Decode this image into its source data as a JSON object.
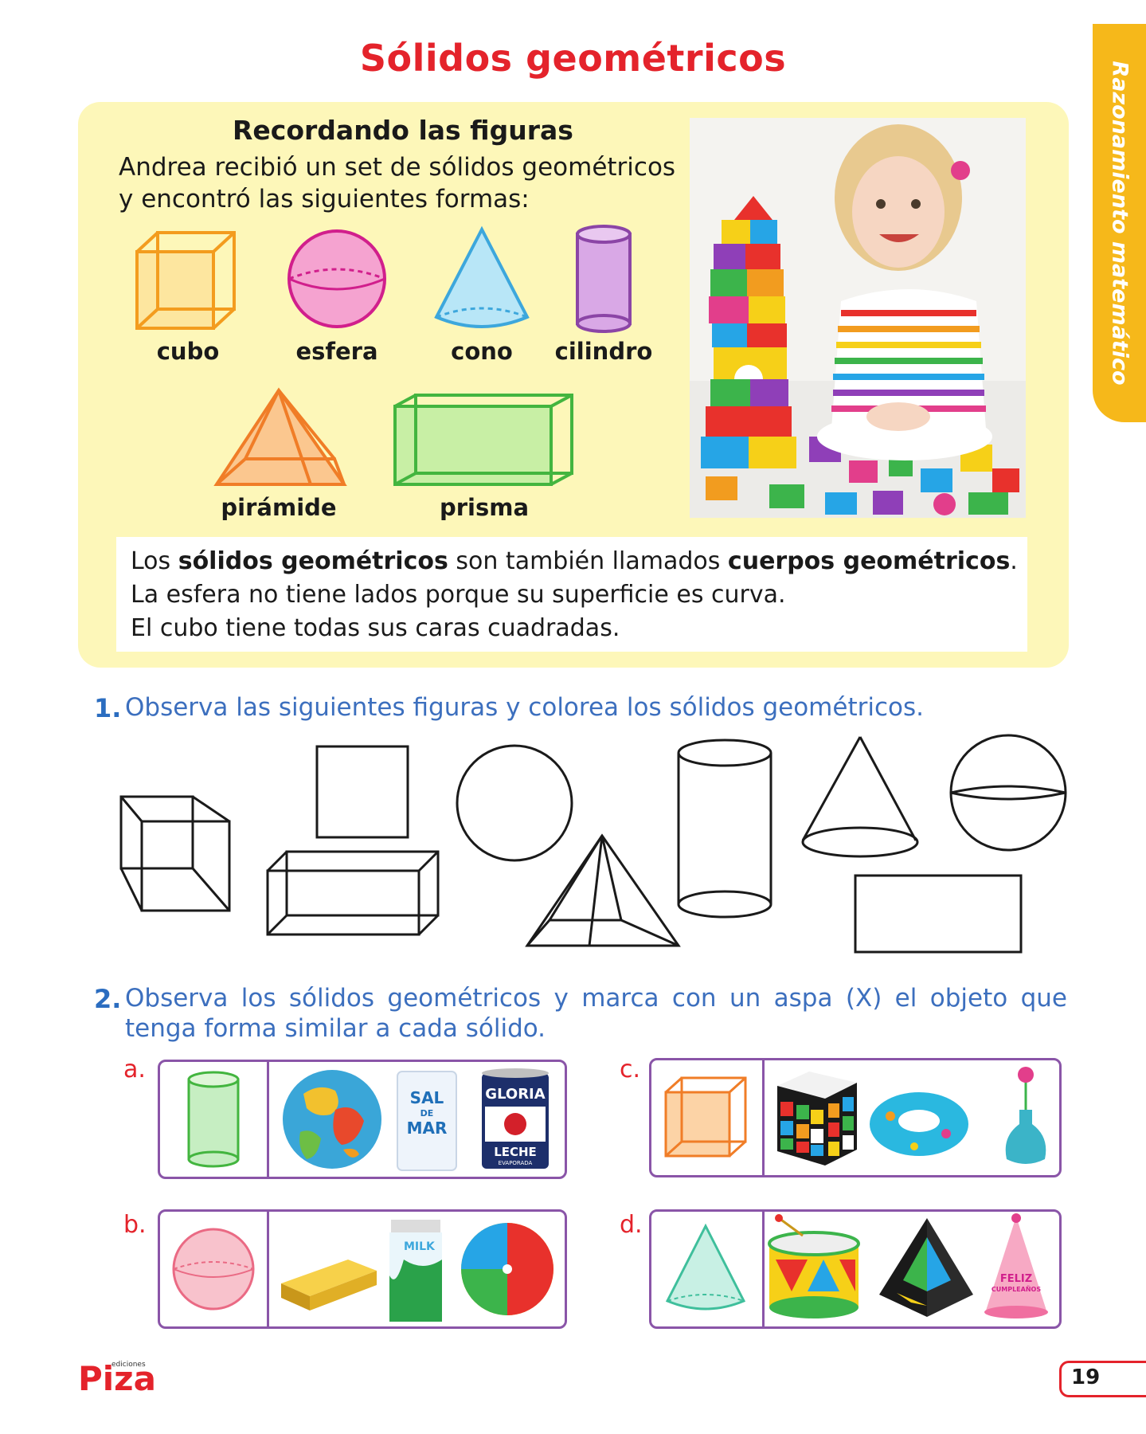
{
  "page": {
    "title": "Sólidos geométricos",
    "side_tab": "Razonamiento matemático",
    "page_number": "19",
    "publisher": "Piza",
    "publisher_small": "ediciones"
  },
  "intro": {
    "heading": "Recordando las figuras",
    "line1": "Andrea recibió un set de sólidos geométricos",
    "line2": "y encontró las siguientes formas:",
    "shapes": [
      "cubo",
      "esfera",
      "cono",
      "cilindro",
      "pirámide",
      "prisma"
    ]
  },
  "info": {
    "l1_a": "Los ",
    "l1_b": "sólidos geométricos",
    "l1_c": " son también llamados ",
    "l1_d": "cuerpos geométricos",
    "l1_e": ".",
    "l2": "La esfera no tiene lados porque su superficie es curva.",
    "l3": "El cubo tiene todas sus caras cuadradas."
  },
  "exercise1": {
    "number": "1.",
    "text": "Observa las siguientes figuras y colorea los sólidos geométricos."
  },
  "exercise2": {
    "number": "2.",
    "text_line1": "Observa los sólidos geométricos y marca con un aspa (X) el objeto que",
    "text_line2": "tenga forma similar a cada sólido.",
    "items": [
      {
        "letter": "a.",
        "sal_1": "SAL",
        "sal_2": "DE",
        "sal_3": "MAR",
        "gloria": "GLORIA",
        "leche": "LECHE",
        "evaporada": "EVAPORADA"
      },
      {
        "letter": "b.",
        "milk": "MILK"
      },
      {
        "letter": "c."
      },
      {
        "letter": "d.",
        "feliz": "FELIZ",
        "cumple": "CUMPLEAÑOS"
      }
    ]
  },
  "colors": {
    "title_red": "#e4232b",
    "tab_yellow": "#f6b81a",
    "box_yellow": "#fdf7b9",
    "exercise_blue": "#3c6fbe",
    "frame_purple": "#8a55a8"
  }
}
